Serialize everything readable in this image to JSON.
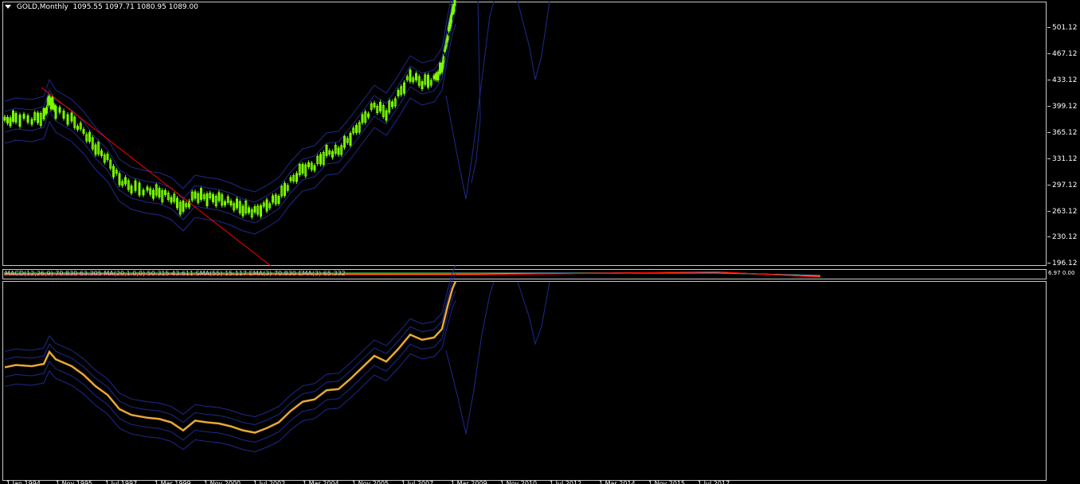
{
  "title": {
    "symbol": "GOLD,Monthly",
    "ohlc": "1095.55 1097.71 1080.95 1089.00"
  },
  "price_axis": {
    "ticks": [
      "501.12",
      "467.12",
      "433.12",
      "399.12",
      "365.12",
      "331.12",
      "297.12",
      "263.12",
      "230.12",
      "196.12"
    ]
  },
  "macd_axis": {
    "labels": [
      "6.97",
      "0.00"
    ]
  },
  "macd_label": "MACD(12,26,9) 70.830 63.305 MA(20,1.0,0) 50.315 43.611 SMA(55) 15.117 EMA(3) 70.830 EMA(3) 65.332",
  "time_axis": {
    "labels": [
      "1 Jan 1994",
      "1 Nov 1995",
      "1 Jul 1997",
      "1 Mar 1999",
      "1 Nov 2000",
      "1 Jul 2002",
      "1 Mar 2004",
      "1 Nov 2005",
      "1 Jul 2007",
      "1 Mar 2009",
      "1 Nov 2010",
      "1 Jul 2012",
      "1 Mar 2014",
      "1 Nov 2015",
      "1 Jul 2017"
    ]
  },
  "colors": {
    "background": "#000000",
    "frame": "#c8c8c8",
    "bull_candle": "#7cfc00",
    "bands": "#1e2a8c",
    "trendline": "#ff0000",
    "price_line": "#e8a838"
  }
}
